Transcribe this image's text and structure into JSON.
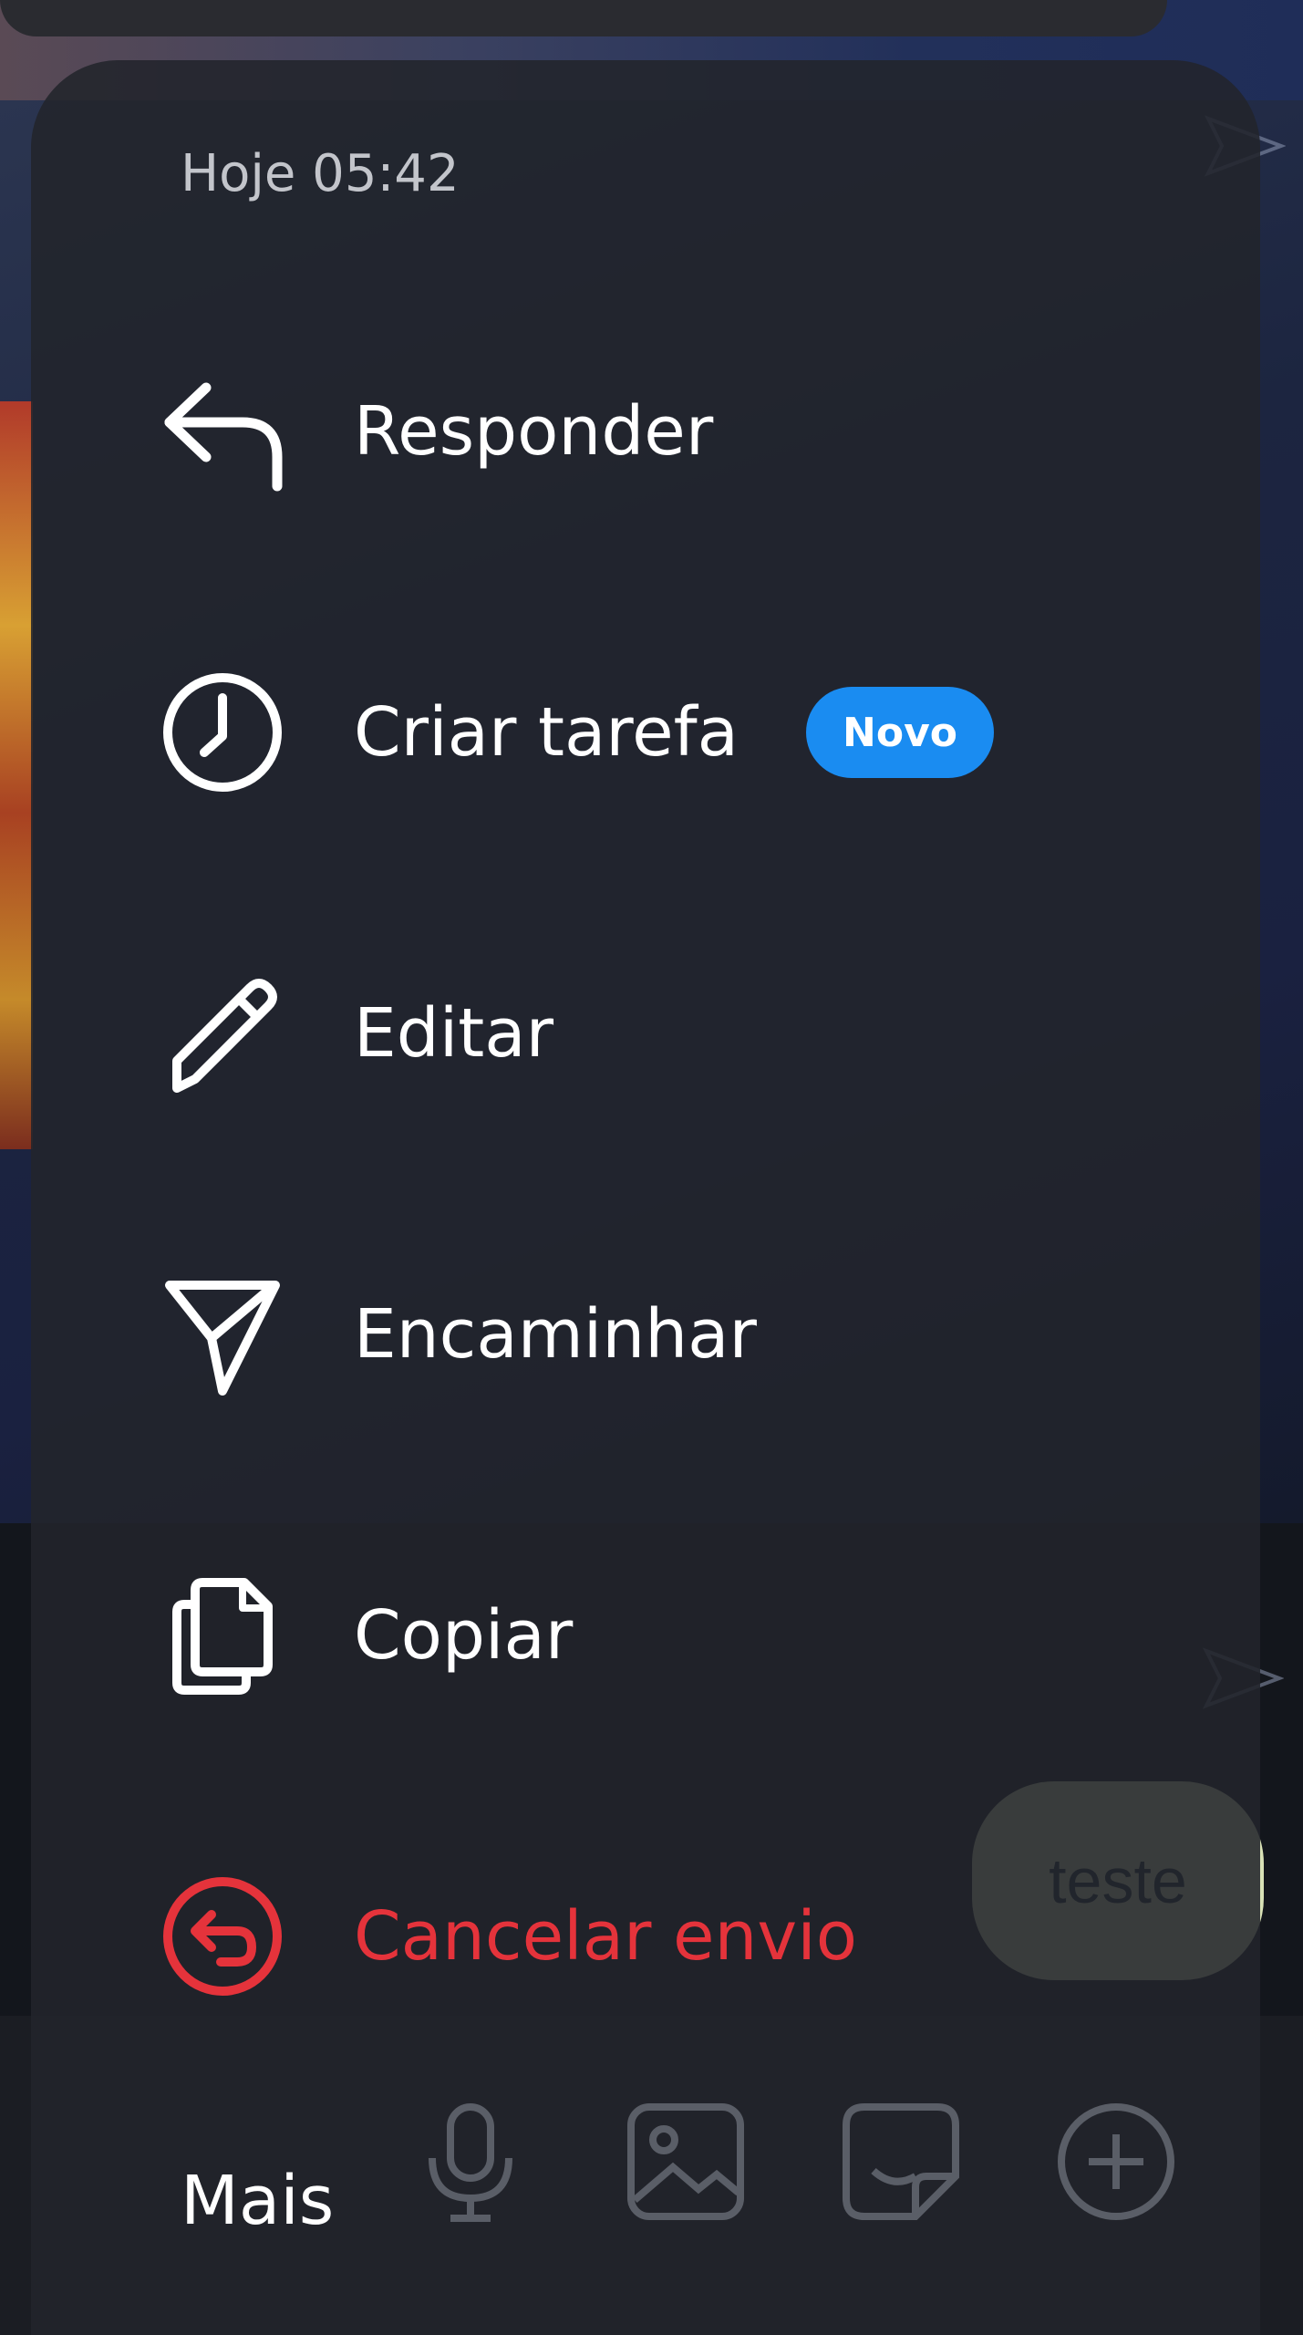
{
  "timestamp": "Hoje 05:42",
  "menu": {
    "items": [
      {
        "label": "Responder",
        "icon": "reply-icon"
      },
      {
        "label": "Criar tarefa",
        "icon": "clock-icon",
        "badge": "Novo"
      },
      {
        "label": "Editar",
        "icon": "pencil-icon"
      },
      {
        "label": "Encaminhar",
        "icon": "forward-icon"
      },
      {
        "label": "Copiar",
        "icon": "copy-icon"
      },
      {
        "label": "Cancelar envio",
        "icon": "undo-circle-icon",
        "danger": true
      }
    ],
    "more_label": "Mais"
  },
  "background": {
    "bubble_text": "teste",
    "composer_icons": [
      "microphone-icon",
      "image-icon",
      "sticker-icon",
      "plus-circle-icon"
    ]
  },
  "colors": {
    "danger": "#e5333b",
    "badge": "#1a8cf1",
    "sheet": "#22242b"
  }
}
